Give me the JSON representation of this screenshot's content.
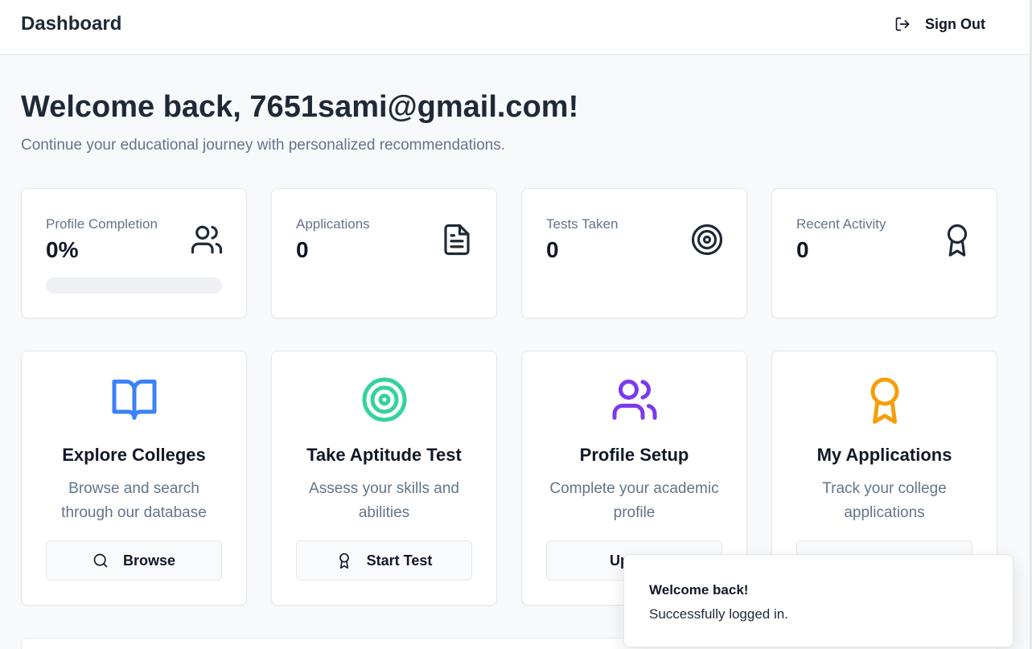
{
  "header": {
    "title": "Dashboard",
    "sign_out_label": "Sign Out"
  },
  "welcome": {
    "title": "Welcome back, 7651sami@gmail.com!",
    "subtitle": "Continue your educational journey with personalized recommendations."
  },
  "stats": [
    {
      "label": "Profile Completion",
      "value": "0%",
      "icon": "users-icon",
      "progress": 0
    },
    {
      "label": "Applications",
      "value": "0",
      "icon": "document-icon"
    },
    {
      "label": "Tests Taken",
      "value": "0",
      "icon": "target-icon"
    },
    {
      "label": "Recent Activity",
      "value": "0",
      "icon": "award-icon"
    }
  ],
  "actions": [
    {
      "title": "Explore Colleges",
      "description": "Browse and search through our database",
      "button": "Browse",
      "icon": "book-open-icon",
      "color": "#3b82f6"
    },
    {
      "title": "Take Aptitude Test",
      "description": "Assess your skills and abilities",
      "button": "Start Test",
      "icon": "target-icon",
      "color": "#34d399"
    },
    {
      "title": "Profile Setup",
      "description": "Complete your academic profile",
      "button": "Update",
      "icon": "users-icon",
      "color": "#7c3aed"
    },
    {
      "title": "My Applications",
      "description": "Track your college applications",
      "button": "",
      "icon": "award-icon",
      "color": "#f59e0b"
    }
  ],
  "toast": {
    "title": "Welcome back!",
    "message": "Successfully logged in."
  }
}
